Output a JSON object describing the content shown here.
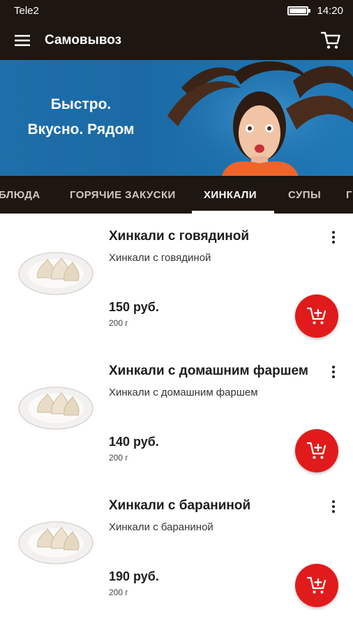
{
  "status_bar": {
    "carrier": "Tele2",
    "time": "14:20",
    "battery_level": 1.0
  },
  "app_bar": {
    "title": "Самовывоз",
    "menu_icon": "hamburger-menu-icon",
    "cart_icon": "cart-icon"
  },
  "banner": {
    "line1": "Быстро.",
    "line2": "Вкусно. Рядом"
  },
  "tabs": [
    {
      "label": "БЛЮДА",
      "active": false
    },
    {
      "label": "ГОРЯЧИЕ ЗАКУСКИ",
      "active": false
    },
    {
      "label": "ХИНКАЛИ",
      "active": true
    },
    {
      "label": "СУПЫ",
      "active": false
    },
    {
      "label": "Г",
      "active": false
    }
  ],
  "products": [
    {
      "title": "Хинкали с говядиной",
      "description": "Хинкали с говядиной",
      "price": "150 руб.",
      "weight": "200 г"
    },
    {
      "title": "Хинкали с домашним фаршем",
      "description": "Хинкали с домашним фаршем",
      "price": "140 руб.",
      "weight": "200 г"
    },
    {
      "title": "Хинкали с бараниной",
      "description": "Хинкали с бараниной",
      "price": "190 руб.",
      "weight": "200 г"
    }
  ],
  "colors": {
    "dark": "#1d1611",
    "accent_red": "#e11b1b",
    "banner_blue": "#1b6aa5"
  }
}
